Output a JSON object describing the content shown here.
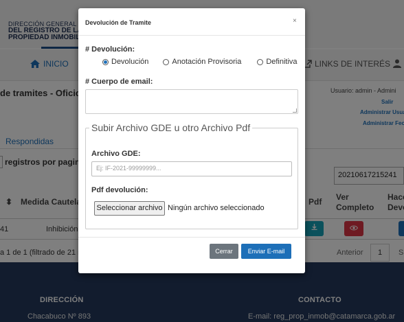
{
  "background": {
    "logo": {
      "line1": "DIRECCIÓN GENERAL",
      "line2": "DEL REGISTRO DE LA",
      "line3": "PROPIEDAD INMOBILI"
    },
    "nav": {
      "inicio": "INICIO",
      "links": "LINKS DE INTERÉS"
    },
    "page_title": "de tramites - Oficios J",
    "user_info": "Usuario: admin - Admini",
    "links": {
      "salir": "Salir",
      "admin_usu": "Administrar Usua",
      "admin_fec": "Administrar Fec"
    },
    "tab_respondidas": "Respondidas",
    "registros_por_pagina": "registros por pagina",
    "search_value": "20210617215241",
    "table": {
      "headers": {
        "medida": "Medida Cautelar",
        "pdf": "Pdf",
        "ver_completo": "Ver Completo",
        "hace_devol": "Hace Devol"
      },
      "row": {
        "id": "41",
        "medida": "Inhibición"
      }
    },
    "footer_info": "a 1 de 1 (filtrado de 21 re",
    "pagination": {
      "anterior": "Anterior",
      "page": "1",
      "siguiente": "S"
    },
    "footer": {
      "direccion_title": "DIRECCIÓN",
      "direccion_text": "Chacabuco Nº 893",
      "contacto_title": "CONTACTO",
      "contacto_text": "E-mail: reg_prop_inmob@catamarca.gob.ar"
    }
  },
  "modal": {
    "title": "Devolución de Tramite",
    "close": "×",
    "devolucion_label": "# Devolución:",
    "radios": [
      {
        "label": "Devolución",
        "checked": true
      },
      {
        "label": "Anotación Provisoria",
        "checked": false
      },
      {
        "label": "Definitiva",
        "checked": false
      }
    ],
    "cuerpo_label": "# Cuerpo de email:",
    "fieldset_legend": "Subir Archivo GDE u otro Archivo Pdf",
    "gde_label": "Archivo GDE:",
    "gde_placeholder": "Ej: IF-2021-99999999...",
    "pdf_label": "Pdf devolución:",
    "file_button": "Seleccionar archivo",
    "file_status": "Ningún archivo seleccionado",
    "cerrar": "Cerrar",
    "enviar": "Enviar E-mail"
  },
  "colors": {
    "primary": "#1d6fb8",
    "secondary": "#6c757d",
    "footer_bg": "#24395c",
    "danger": "#dc3545",
    "info": "#17a2b8"
  }
}
